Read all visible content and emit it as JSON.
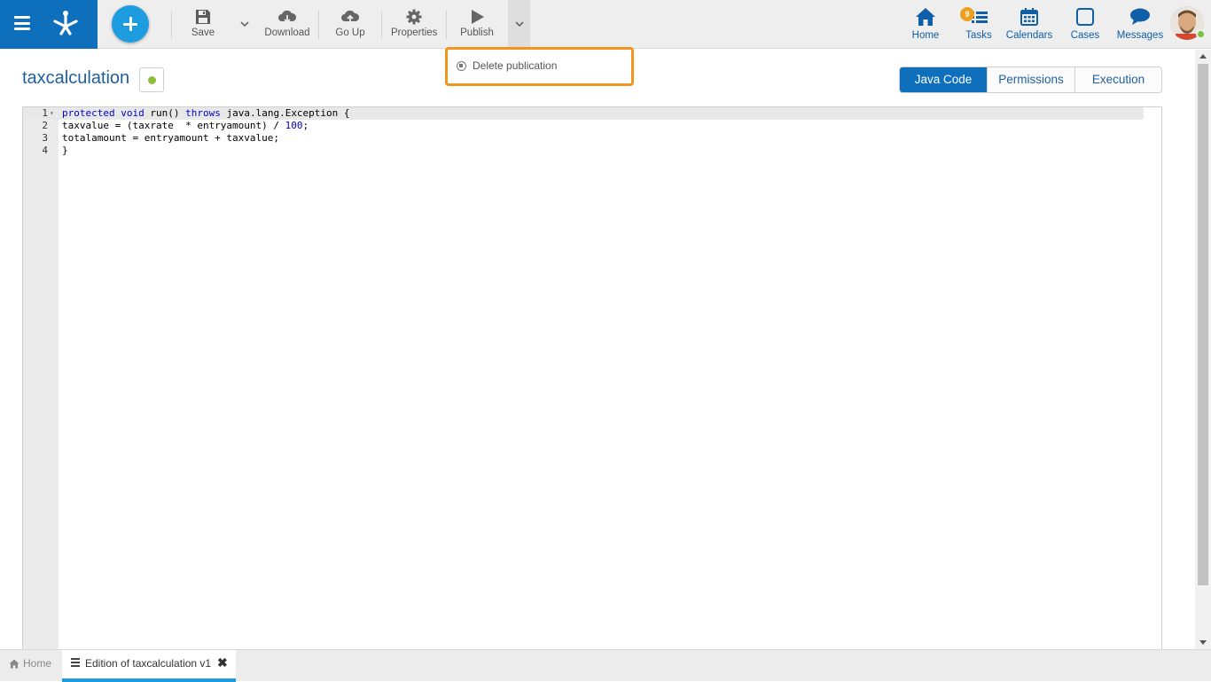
{
  "toolbar": {
    "save_label": "Save",
    "download_label": "Download",
    "go_up_label": "Go Up",
    "properties_label": "Properties",
    "publish_label": "Publish"
  },
  "publish_menu": {
    "delete_publication_label": "Delete publication"
  },
  "nav": {
    "home_label": "Home",
    "tasks_label": "Tasks",
    "tasks_badge": "9",
    "calendars_label": "Calendars",
    "cases_label": "Cases",
    "messages_label": "Messages"
  },
  "page": {
    "title": "taxcalculation",
    "status_color": "#8dbf3c"
  },
  "tabs": [
    {
      "label": "Java Code",
      "active": true
    },
    {
      "label": "Permissions",
      "active": false
    },
    {
      "label": "Execution",
      "active": false
    }
  ],
  "editor": {
    "line_numbers": [
      "1",
      "2",
      "3",
      "4"
    ],
    "lines": [
      "protected void run() throws java.lang.Exception {",
      "taxvalue = (taxrate  * entryamount) / 100;",
      "totalamount = entryamount + taxvalue;",
      "}"
    ]
  },
  "bottom_tabs": {
    "home_label": "Home",
    "document_label": "Edition of taxcalculation v1"
  },
  "colors": {
    "brand": "#0e6fbd",
    "accent": "#1e9ce0",
    "highlight": "#f0961e"
  }
}
